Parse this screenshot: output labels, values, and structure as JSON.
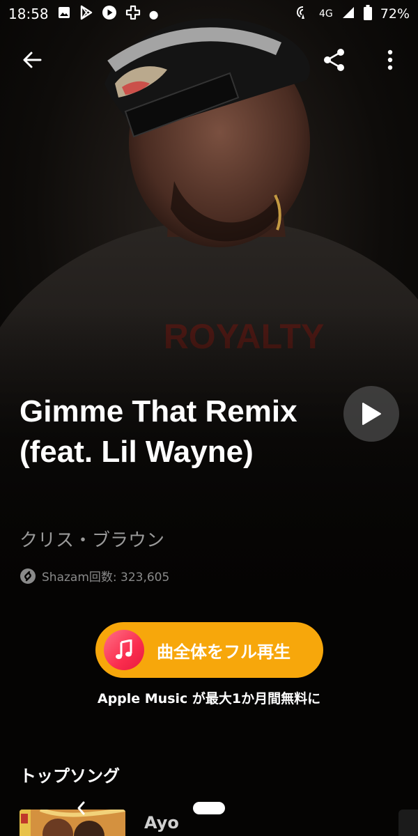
{
  "status_bar": {
    "time": "18:58",
    "network": "4G",
    "battery": "72%",
    "notification_icons": [
      "image-icon",
      "play-store-icon",
      "play-circle-icon",
      "plus-cross-icon"
    ],
    "right_icons": [
      "hotspot-icon",
      "signal-icon",
      "battery-icon"
    ]
  },
  "app_bar": {
    "icons": [
      "back-arrow-icon",
      "share-icon",
      "more-vert-icon"
    ]
  },
  "track": {
    "title": "Gimme That Remix (feat. Lil Wayne)",
    "artist": "クリス・ブラウン",
    "shazam_count": "Shazam回数: 323,605"
  },
  "cta": {
    "label": "曲全体をフル再生",
    "subtitle": "Apple Music が最大1か月間無料に",
    "color": "#f7a70b",
    "icon": "music-note-icon"
  },
  "top_songs": {
    "title": "トップソング",
    "items": [
      {
        "title": "Ayo"
      }
    ]
  },
  "colors": {
    "background": "#050403",
    "secondary_text": "#9a9a9a",
    "accent": "#f7a70b"
  }
}
